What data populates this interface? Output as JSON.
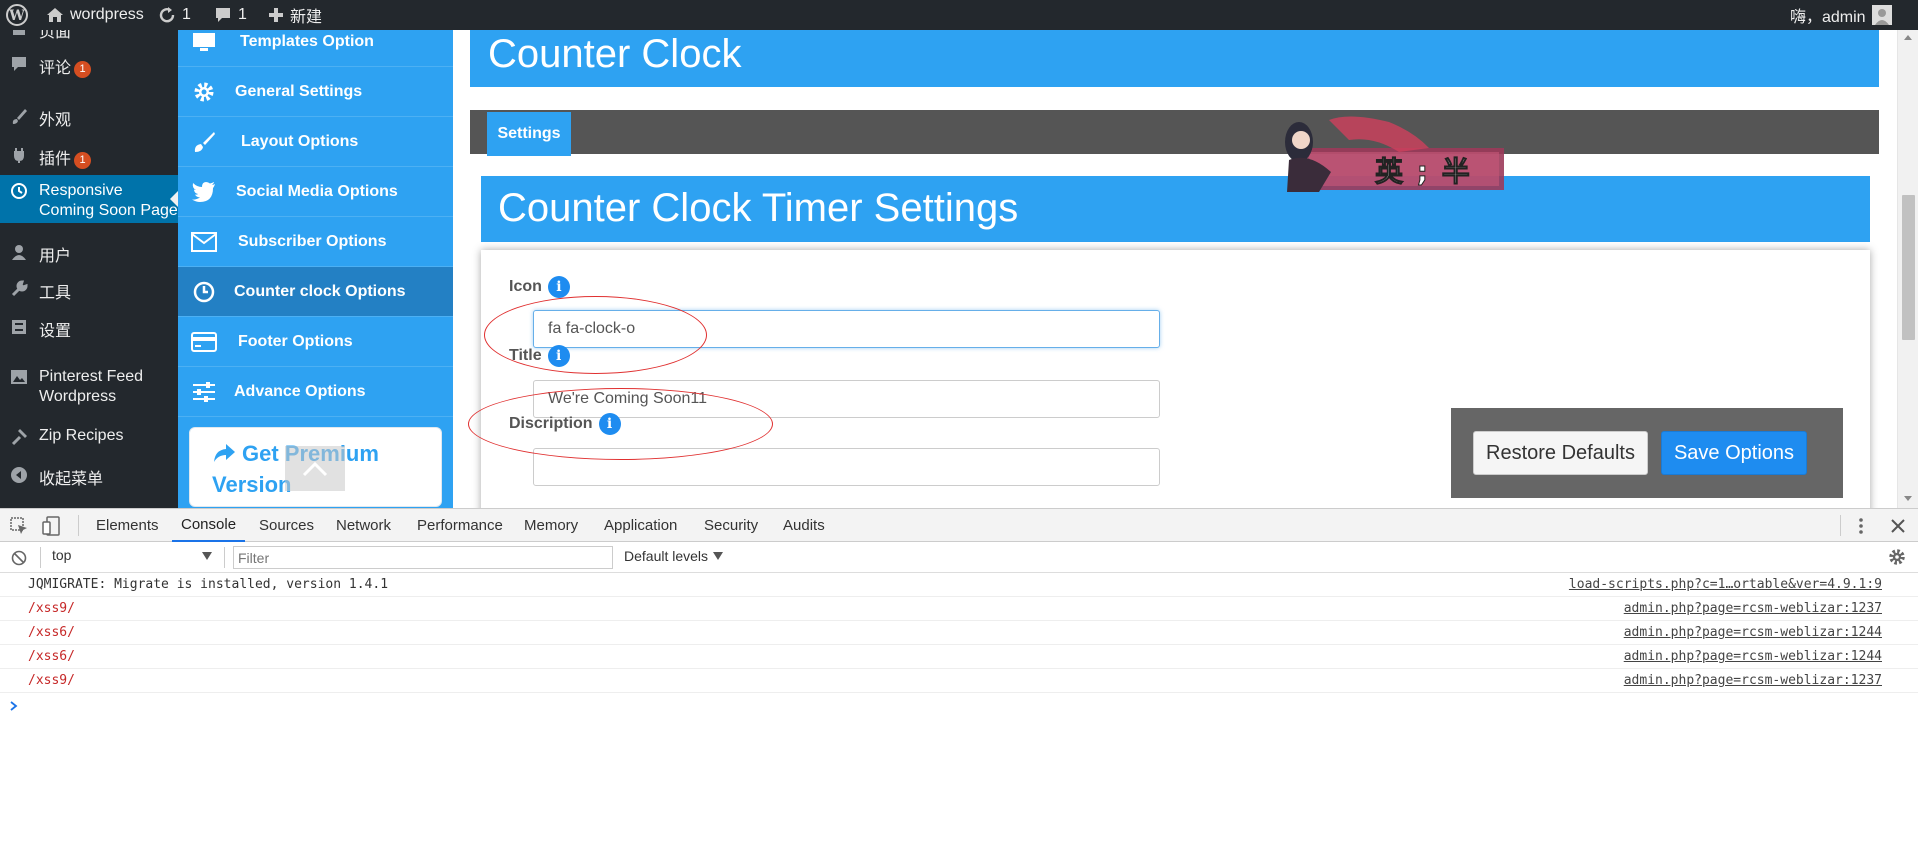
{
  "adminbar": {
    "site_name": "wordpress",
    "updates_count": "1",
    "comments_count": "1",
    "new_label": "新建",
    "greeting": "嗨，admin"
  },
  "wp_menu": {
    "items": [
      {
        "label": "页面",
        "icon": "page-icon"
      },
      {
        "label": "评论",
        "icon": "comment-icon",
        "badge": "1"
      },
      {
        "label": "外观",
        "icon": "paintbrush-icon"
      },
      {
        "label": "插件",
        "icon": "plugin-icon",
        "badge": "1"
      },
      {
        "label": "Responsive Coming Soon Page",
        "icon": "clock-history-icon",
        "active": true
      },
      {
        "label": "用户",
        "icon": "user-icon"
      },
      {
        "label": "工具",
        "icon": "wrench-icon"
      },
      {
        "label": "设置",
        "icon": "settings-icon"
      },
      {
        "label": "Pinterest Feed Wordpress",
        "icon": "image-icon"
      },
      {
        "label": "Zip Recipes",
        "icon": "hammer-icon"
      },
      {
        "label": "收起菜单",
        "icon": "collapse-icon"
      }
    ]
  },
  "plugin_menu": {
    "items": [
      {
        "label": "Templates Option",
        "icon": "monitor-icon"
      },
      {
        "label": "General Settings",
        "icon": "gear-icon"
      },
      {
        "label": "Layout Options",
        "icon": "paintbrush-icon"
      },
      {
        "label": "Social Media Options",
        "icon": "twitter-icon"
      },
      {
        "label": "Subscriber Options",
        "icon": "envelope-icon"
      },
      {
        "label": "Counter clock Options",
        "icon": "clock-icon",
        "active": true
      },
      {
        "label": "Footer Options",
        "icon": "credit-card-icon"
      },
      {
        "label": "Advance Options",
        "icon": "sliders-icon"
      }
    ],
    "premium_label": "Get Premium Version"
  },
  "main": {
    "header_title": "Counter Clock",
    "tab_label": "Settings",
    "banner_text": "英 ; 半",
    "section_title": "Counter Clock Timer Settings",
    "fields": {
      "icon_label": "Icon",
      "icon_value": "fa fa-clock-o",
      "title_label": "Title",
      "title_value": "We're Coming Soon11",
      "description_label": "Discription"
    },
    "restore_label": "Restore Defaults",
    "save_label": "Save Options"
  },
  "devtools": {
    "tabs": [
      "Elements",
      "Console",
      "Sources",
      "Network",
      "Performance",
      "Memory",
      "Application",
      "Security",
      "Audits"
    ],
    "active_tab": "Console",
    "context": "top",
    "filter_placeholder": "Filter",
    "levels": "Default levels",
    "logs": [
      {
        "message": "JQMIGRATE: Migrate is installed, version 1.4.1",
        "source": "load-scripts.php?c=1…ortable&ver=4.9.1:9",
        "red": false
      },
      {
        "message": "/xss9/",
        "source": "admin.php?page=rcsm-weblizar:1237",
        "red": true
      },
      {
        "message": "/xss6/",
        "source": "admin.php?page=rcsm-weblizar:1244",
        "red": true
      },
      {
        "message": "/xss6/",
        "source": "admin.php?page=rcsm-weblizar:1244",
        "red": true
      },
      {
        "message": "/xss9/",
        "source": "admin.php?page=rcsm-weblizar:1237",
        "red": true
      }
    ]
  },
  "colors": {
    "accent": "#2ea2f2",
    "wp_dark": "#23282d",
    "wp_active": "#0073aa",
    "annotation": "#e03030"
  }
}
